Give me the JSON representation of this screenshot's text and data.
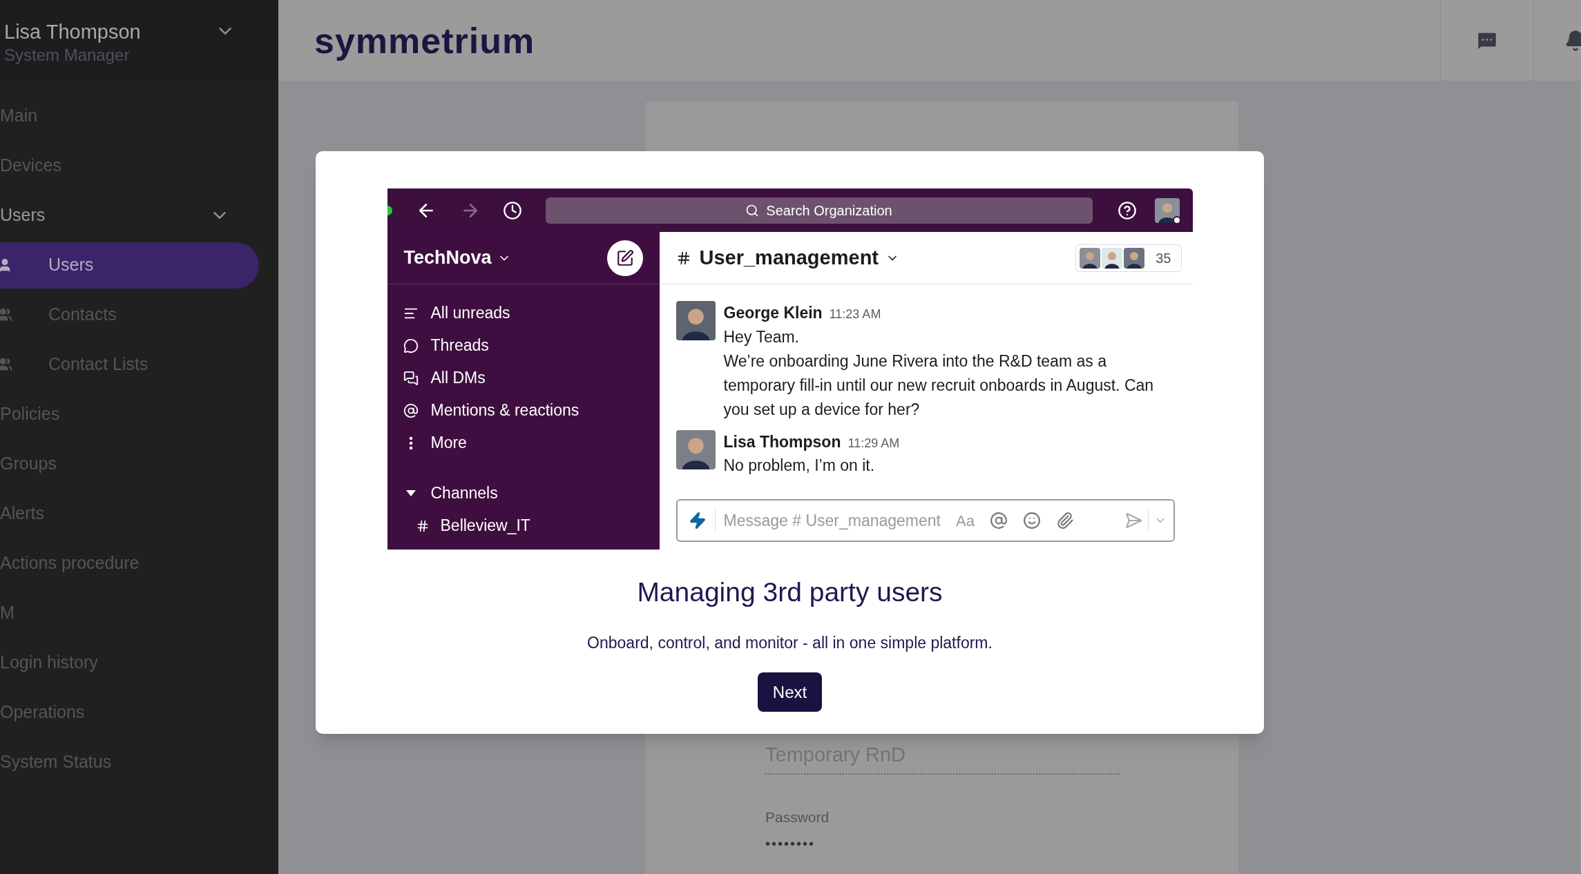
{
  "sidebar": {
    "user": {
      "name": "Lisa Thompson",
      "role": "System Manager"
    },
    "items": [
      {
        "label": "Main",
        "kind": "link",
        "selected": false
      },
      {
        "label": "Devices",
        "kind": "link",
        "selected": false
      },
      {
        "label": "Users",
        "kind": "section",
        "selected": false
      },
      {
        "label": "Users",
        "kind": "user",
        "selected": true
      },
      {
        "label": "Contacts",
        "kind": "group",
        "selected": false
      },
      {
        "label": "Contact Lists",
        "kind": "group",
        "selected": false
      },
      {
        "label": "Policies",
        "kind": "link",
        "selected": false
      },
      {
        "label": "Groups",
        "kind": "link",
        "selected": false
      },
      {
        "label": "Alerts",
        "kind": "link",
        "selected": false
      },
      {
        "label": "Actions procedure",
        "kind": "link",
        "selected": false
      },
      {
        "label": "M",
        "kind": "link",
        "selected": false
      },
      {
        "label": "Login history",
        "kind": "link",
        "selected": false
      },
      {
        "label": "Operations",
        "kind": "link",
        "selected": false
      },
      {
        "label": "System Status",
        "kind": "link",
        "selected": false
      }
    ]
  },
  "header": {
    "logo": "symmetrium"
  },
  "background_form": {
    "name_value": "Temporary RnD",
    "password": {
      "label": "Password",
      "value": "••••••••"
    }
  },
  "modal": {
    "screenshot": {
      "search": {
        "placeholder": "Search Organization"
      },
      "workspace": "TechNova",
      "nav": [
        {
          "label": "All unreads",
          "kind": "unreads"
        },
        {
          "label": "Threads",
          "kind": "threads"
        },
        {
          "label": "All DMs",
          "kind": "dms"
        },
        {
          "label": "Mentions & reactions",
          "kind": "mentions"
        },
        {
          "label": "More",
          "kind": "more"
        }
      ],
      "channels": {
        "label": "Channels",
        "expanded": true,
        "items": [
          {
            "name": "Belleview_IT"
          }
        ]
      },
      "channel": {
        "name": "User_management",
        "member_count": "35"
      },
      "messages": [
        {
          "author": "George Klein",
          "time": "11:23 AM",
          "lines": [
            "Hey Team.",
            "We’re onboarding June Rivera into the R&D team as a temporary fill-in until our new recruit onboards in August. Can you set up a device for her?"
          ]
        },
        {
          "author": "Lisa Thompson",
          "time": "11:29 AM",
          "lines": [
            "No problem, I’m on it."
          ]
        }
      ],
      "composer": {
        "placeholder": "Message # User_management",
        "format_label": "Aa"
      }
    },
    "title": "Managing 3rd party users",
    "subtitle": "Onboard, control, and monitor - all in one simple platform.",
    "button": "Next"
  }
}
